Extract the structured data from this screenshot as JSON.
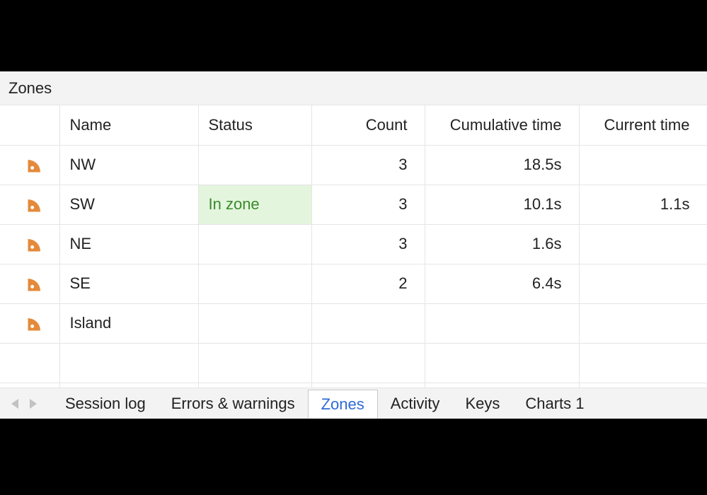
{
  "panel": {
    "title": "Zones"
  },
  "table": {
    "columns": [
      "",
      "Name",
      "Status",
      "Count",
      "Cumulative time",
      "Current time"
    ],
    "rows": [
      {
        "name": "NW",
        "status": "",
        "count": "3",
        "cume": "18.5s",
        "cur": "",
        "in_zone": false
      },
      {
        "name": "SW",
        "status": "In zone",
        "count": "3",
        "cume": "10.1s",
        "cur": "1.1s",
        "in_zone": true
      },
      {
        "name": "NE",
        "status": "",
        "count": "3",
        "cume": "1.6s",
        "cur": "",
        "in_zone": false
      },
      {
        "name": "SE",
        "status": "",
        "count": "2",
        "cume": "6.4s",
        "cur": "",
        "in_zone": false
      },
      {
        "name": "Island",
        "status": "",
        "count": "",
        "cume": "",
        "cur": "",
        "in_zone": false
      }
    ],
    "blank_trailing_rows": 2
  },
  "tabs": {
    "items": [
      {
        "label": "Session log",
        "active": false
      },
      {
        "label": "Errors & warnings",
        "active": false
      },
      {
        "label": "Zones",
        "active": true
      },
      {
        "label": "Activity",
        "active": false
      },
      {
        "label": "Keys",
        "active": false
      },
      {
        "label": "Charts 1",
        "active": false
      }
    ]
  },
  "colors": {
    "accent_orange": "#e48a3a",
    "in_zone_bg": "#e4f5dd",
    "in_zone_fg": "#3a8a2d",
    "active_tab_fg": "#2e6bd6"
  }
}
